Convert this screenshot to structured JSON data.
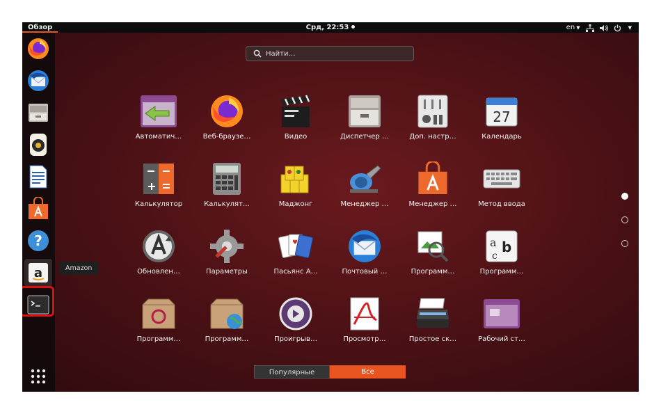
{
  "topbar": {
    "activities": "Обзор",
    "clock": "Срд, 22:53",
    "lang": "en"
  },
  "dock": {
    "tooltip": "Amazon",
    "items": [
      "firefox-icon",
      "thunderbird-icon",
      "files-icon",
      "rhythmbox-icon",
      "writer-icon",
      "software-center-icon",
      "help-icon",
      "amazon-icon",
      "terminal-icon",
      "show-apps-icon"
    ]
  },
  "search": {
    "placeholder": "Найти…"
  },
  "apps": [
    {
      "label": "Автоматич…",
      "icon": "startup-apps-icon"
    },
    {
      "label": "Веб-браузе…",
      "icon": "firefox-icon"
    },
    {
      "label": "Видео",
      "icon": "video-clapper-icon"
    },
    {
      "label": "Диспетчер …",
      "icon": "archive-manager-icon"
    },
    {
      "label": "Доп. настр…",
      "icon": "tweaks-icon"
    },
    {
      "label": "Календарь",
      "icon": "calendar-icon",
      "day": "27"
    },
    {
      "label": "Калькулятор",
      "icon": "calculator-icon"
    },
    {
      "label": "Калькулят…",
      "icon": "calculator-gray-icon"
    },
    {
      "label": "Маджонг",
      "icon": "mahjong-icon"
    },
    {
      "label": "Менеджер …",
      "icon": "package-manager-icon"
    },
    {
      "label": "Менеджер …",
      "icon": "software-bag-icon"
    },
    {
      "label": "Метод ввода",
      "icon": "keyboard-icon"
    },
    {
      "label": "Обновлен…",
      "icon": "software-updater-icon"
    },
    {
      "label": "Параметры",
      "icon": "settings-gear-icon"
    },
    {
      "label": "Пасьянс А…",
      "icon": "solitaire-cards-icon"
    },
    {
      "label": "Почтовый …",
      "icon": "thunderbird-icon"
    },
    {
      "label": "Программ…",
      "icon": "photo-magnifier-icon"
    },
    {
      "label": "Программ…",
      "icon": "fonts-icon"
    },
    {
      "label": "Программ…",
      "icon": "debian-package-icon"
    },
    {
      "label": "Программ…",
      "icon": "package-globe-icon"
    },
    {
      "label": "Проигрыв…",
      "icon": "media-player-icon"
    },
    {
      "label": "Просмотр…",
      "icon": "document-viewer-icon"
    },
    {
      "label": "Простое ск…",
      "icon": "scanner-icon"
    },
    {
      "label": "Рабочий ст…",
      "icon": "desktop-sharing-icon"
    }
  ],
  "tabs": {
    "popular": "Популярные",
    "all": "Все"
  },
  "colors": {
    "accent": "#e95420",
    "highlight": "#e01010"
  }
}
